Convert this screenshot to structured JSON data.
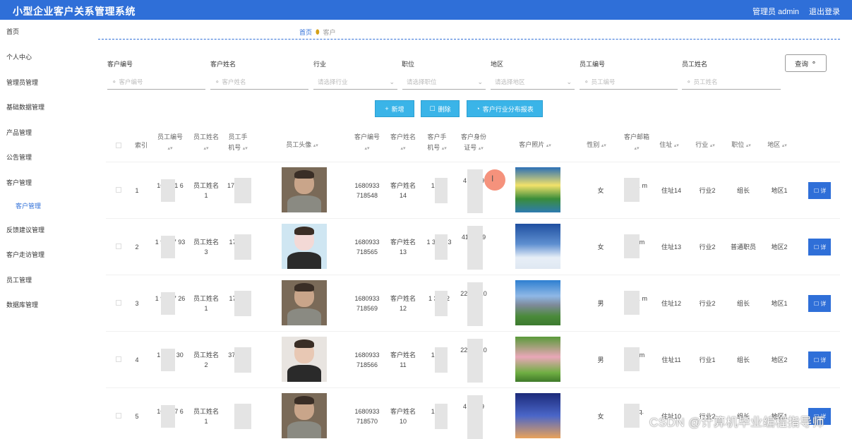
{
  "header": {
    "title": "小型企业客户关系管理系统",
    "admin_label": "管理员 admin",
    "logout_label": "退出登录",
    "accent_color": "#2f6fd8"
  },
  "sidebar": {
    "items": [
      {
        "label": "首页"
      },
      {
        "label": "个人中心"
      },
      {
        "label": "管理员管理"
      },
      {
        "label": "基础数据管理"
      },
      {
        "label": "产品管理"
      },
      {
        "label": "公告管理"
      },
      {
        "label": "客户管理"
      },
      {
        "label": "客户管理"
      },
      {
        "label": "反馈建议管理"
      },
      {
        "label": "客户走访管理"
      },
      {
        "label": "员工管理"
      },
      {
        "label": "数据库管理"
      }
    ]
  },
  "breadcrumb": {
    "home": "首页",
    "current": "客户"
  },
  "search": {
    "fields": [
      {
        "label": "客户编号",
        "placeholder": "客户编号"
      },
      {
        "label": "客户姓名",
        "placeholder": "客户姓名"
      },
      {
        "label": "行业",
        "placeholder": "请选择行业"
      },
      {
        "label": "职位",
        "placeholder": "请选择职位"
      },
      {
        "label": "地区",
        "placeholder": "请选择地区"
      },
      {
        "label": "员工编号",
        "placeholder": "员工编号"
      },
      {
        "label": "员工姓名",
        "placeholder": "员工姓名"
      }
    ],
    "query_label": "查询"
  },
  "actions": {
    "add_label": "新增",
    "delete_label": "删除",
    "report_label": "客户行业分布报表"
  },
  "table": {
    "headers": {
      "index": "索引",
      "emp_no": "员工编号",
      "emp_name": "员工姓名",
      "emp_phone": "员工手机号",
      "emp_avatar": "员工头像",
      "cust_no": "客户编号",
      "cust_name": "客户姓名",
      "cust_phone": "客户手机号",
      "cust_id": "客户身份证号",
      "cust_photo": "客户照片",
      "gender": "性别",
      "email": "客户邮箱",
      "address": "住址",
      "industry": "行业",
      "position": "职位",
      "region": "地区"
    },
    "rows": [
      {
        "index": "1",
        "emp_no": "16 3 71 6",
        "emp_name": "员工姓名1",
        "emp_phone": "17 78 6",
        "cust_no": "1680933718548",
        "cust_name": "客户姓名14",
        "cust_phone": "17 78",
        "cust_id": "4 41 99 10 2",
        "gender": "女",
        "email": "1 qq. m",
        "address": "住址14",
        "industry": "行业2",
        "position": "组长",
        "region": "地区1",
        "detail": "详"
      },
      {
        "index": "2",
        "emp_no": "1 933 7 93",
        "emp_name": "员工姓名3",
        "emp_phone": "17 8 6",
        "cust_no": "1680933718565",
        "cust_name": "客户姓名13",
        "cust_phone": "1 378 13",
        "cust_id": "41 11 99 10",
        "gender": "女",
        "email": "qq. m",
        "address": "住址13",
        "industry": "行业2",
        "position": "普通职员",
        "region": "地区2",
        "detail": "详"
      },
      {
        "index": "3",
        "emp_no": "1 933 7 26",
        "emp_name": "员工姓名1",
        "emp_phone": "17 8 6",
        "cust_no": "1680933718569",
        "cust_name": "客户姓名12",
        "cust_phone": "1 378 2",
        "cust_id": "2241 010 12",
        "gender": "男",
        "email": "1 qq. m",
        "address": "住址12",
        "industry": "行业2",
        "position": "组长",
        "region": "地区1",
        "detail": "详"
      },
      {
        "index": "4",
        "emp_no": "1 33 7 30",
        "emp_name": "员工姓名2",
        "emp_phone": "378 02",
        "cust_no": "1680933718566",
        "cust_name": "客户姓名11",
        "cust_phone": "17 78",
        "cust_id": "2241 010 11",
        "gender": "男",
        "email": "qq. m",
        "address": "住址11",
        "industry": "行业1",
        "position": "组长",
        "region": "地区2",
        "detail": "详"
      },
      {
        "index": "5",
        "emp_no": "16 33 7 6",
        "emp_name": "员工姓名1",
        "emp_phone": "78",
        "cust_no": "1680933718570",
        "cust_name": "客户姓名10",
        "cust_phone": "17 78",
        "cust_id": "4 41 99 10",
        "gender": "女",
        "email": "10 q.",
        "address": "住址10",
        "industry": "行业2",
        "position": "组长",
        "region": "地区1",
        "detail": "详"
      }
    ]
  },
  "watermark": "CSDN @计算机毕业编程指导师"
}
